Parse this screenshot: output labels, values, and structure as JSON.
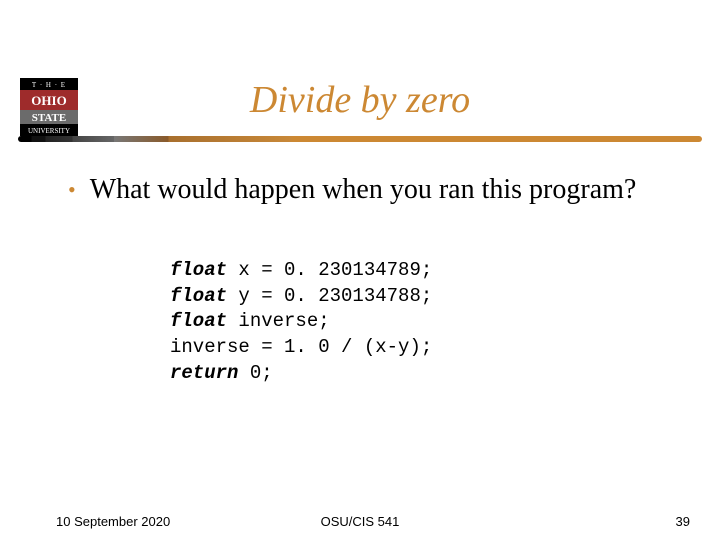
{
  "title": "Divide by zero",
  "bullet": "What would happen when you ran this program?",
  "code": {
    "line1_kw": "float",
    "line1_rest": " x = 0. 230134789;",
    "line2_kw": "float",
    "line2_rest": " y = 0. 230134788;",
    "line3_kw": "float",
    "line3_rest": " inverse;",
    "line4": "inverse = 1. 0 / (x-y);",
    "line5_kw": "return",
    "line5_rest": " 0;"
  },
  "footer": {
    "date": "10 September 2020",
    "course": "OSU/CIS 541",
    "page": "39"
  },
  "logo": {
    "top_text": "T · H · E",
    "mid_text": "OHIO",
    "state_text": "STATE",
    "bottom_text": "UNIVERSITY",
    "colors": {
      "red": "#9e2b2b",
      "grey": "#6b6b6b",
      "white": "#ffffff",
      "black": "#000000"
    }
  }
}
